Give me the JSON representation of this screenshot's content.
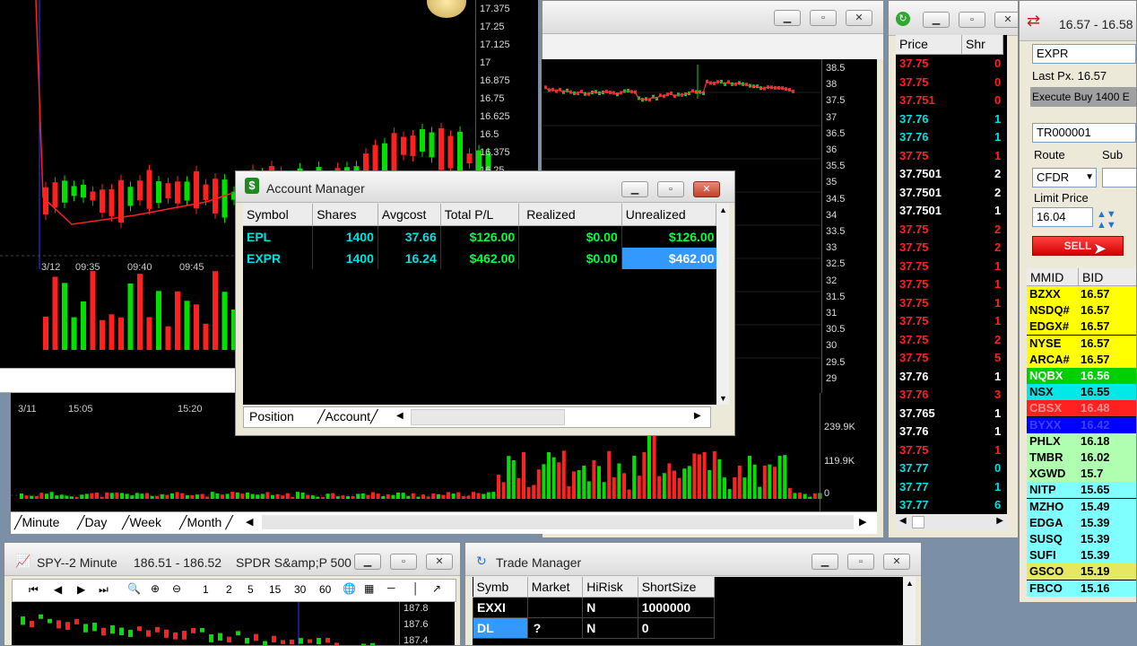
{
  "top_chart": {
    "y_ticks": [
      "17.375",
      "17.25",
      "17.125",
      "17",
      "16.875",
      "16.75",
      "16.625",
      "16.5",
      "16.375",
      "16.25"
    ],
    "x_labels": [
      "3/12",
      "09:35",
      "09:40",
      "09:45"
    ]
  },
  "mid_chart": {
    "x_labels": [
      "3/11",
      "15:05",
      "15:20"
    ],
    "tabs": [
      "Minute",
      "Day",
      "Week",
      "Month"
    ]
  },
  "right_chart": {
    "y_ticks": [
      "38.5",
      "38",
      "37.5",
      "37",
      "36.5",
      "36",
      "35.5",
      "35",
      "34.5",
      "34",
      "33.5",
      "33",
      "32.5",
      "32",
      "31.5",
      "31",
      "30.5",
      "30",
      "29.5",
      "29"
    ],
    "vol_ticks": [
      "239.9K",
      "119.9K",
      "0"
    ]
  },
  "account_manager": {
    "title": "Account Manager",
    "columns": [
      "Symbol",
      "Shares",
      "Avgcost",
      "Total P/L",
      "Realized",
      "Unrealized"
    ],
    "rows": [
      {
        "symbol": "EPL",
        "shares": "1400",
        "avgcost": "37.66",
        "total_pl": "$126.00",
        "realized": "$0.00",
        "unrealized": "$126.00"
      },
      {
        "symbol": "EXPR",
        "shares": "1400",
        "avgcost": "16.24",
        "total_pl": "$462.00",
        "realized": "$0.00",
        "unrealized": "$462.00"
      }
    ],
    "tabs": [
      "Position",
      "Account"
    ]
  },
  "time_sales": {
    "columns": [
      "Price",
      "Shr"
    ],
    "rows": [
      {
        "price": "37.75",
        "shr": "0",
        "color": "#ff2020"
      },
      {
        "price": "37.75",
        "shr": "0",
        "color": "#ff2020"
      },
      {
        "price": "37.751",
        "shr": "0",
        "color": "#ff2020"
      },
      {
        "price": "37.76",
        "shr": "1",
        "color": "#00e0e0"
      },
      {
        "price": "37.76",
        "shr": "1",
        "color": "#00e0e0"
      },
      {
        "price": "37.75",
        "shr": "1",
        "color": "#ff2020"
      },
      {
        "price": "37.7501",
        "shr": "2",
        "color": "#ffffff"
      },
      {
        "price": "37.7501",
        "shr": "2",
        "color": "#ffffff"
      },
      {
        "price": "37.7501",
        "shr": "1",
        "color": "#ffffff"
      },
      {
        "price": "37.75",
        "shr": "2",
        "color": "#ff2020"
      },
      {
        "price": "37.75",
        "shr": "2",
        "color": "#ff2020"
      },
      {
        "price": "37.75",
        "shr": "1",
        "color": "#ff2020"
      },
      {
        "price": "37.75",
        "shr": "1",
        "color": "#ff2020"
      },
      {
        "price": "37.75",
        "shr": "1",
        "color": "#ff2020"
      },
      {
        "price": "37.75",
        "shr": "1",
        "color": "#ff2020"
      },
      {
        "price": "37.75",
        "shr": "2",
        "color": "#ff2020"
      },
      {
        "price": "37.75",
        "shr": "5",
        "color": "#ff2020"
      },
      {
        "price": "37.76",
        "shr": "1",
        "color": "#ffffff"
      },
      {
        "price": "37.76",
        "shr": "3",
        "color": "#ff2020"
      },
      {
        "price": "37.765",
        "shr": "1",
        "color": "#ffffff"
      },
      {
        "price": "37.76",
        "shr": "1",
        "color": "#ffffff"
      },
      {
        "price": "37.75",
        "shr": "1",
        "color": "#ff2020"
      },
      {
        "price": "37.77",
        "shr": "0",
        "color": "#00e0e0"
      },
      {
        "price": "37.77",
        "shr": "1",
        "color": "#00e0e0"
      },
      {
        "price": "37.77",
        "shr": "6",
        "color": "#00e0e0"
      }
    ]
  },
  "order_entry": {
    "title": "16.57 - 16.58",
    "symbol": "EXPR",
    "last_px_label": "Last Px.",
    "last_px": "16.57",
    "execute_text": "Execute Buy 1400 E",
    "account": "TR000001",
    "route_label": "Route",
    "sub_label": "Sub",
    "route": "CFDR",
    "limit_label": "Limit Price",
    "limit_price": "16.04",
    "sell_label": "SELL",
    "level2_columns": [
      "MMID",
      "BID"
    ],
    "level2": [
      {
        "mmid": "BZXX",
        "bid": "16.57",
        "bg": "#ffff00",
        "fg": "#000"
      },
      {
        "mmid": "NSDQ#",
        "bid": "16.57",
        "bg": "#ffff00",
        "fg": "#000"
      },
      {
        "mmid": "EDGX#",
        "bid": "16.57",
        "bg": "#ffff00",
        "fg": "#000"
      },
      {
        "mmid": "NYSE",
        "bid": "16.57",
        "bg": "#ffff00",
        "fg": "#000"
      },
      {
        "mmid": "ARCA#",
        "bid": "16.57",
        "bg": "#ffff00",
        "fg": "#000"
      },
      {
        "mmid": "NQBX",
        "bid": "16.56",
        "bg": "#00d000",
        "fg": "#ffffff"
      },
      {
        "mmid": "NSX",
        "bid": "16.55",
        "bg": "#00e8e8",
        "fg": "#000"
      },
      {
        "mmid": "CBSX",
        "bid": "16.48",
        "bg": "#ff2020",
        "fg": "#ff9090"
      },
      {
        "mmid": "BYXX",
        "bid": "16.42",
        "bg": "#0000ff",
        "fg": "#4040ff"
      },
      {
        "mmid": "PHLX",
        "bid": "16.18",
        "bg": "#b0ffb0",
        "fg": "#000"
      },
      {
        "mmid": "TMBR",
        "bid": "16.02",
        "bg": "#b0ffb0",
        "fg": "#000"
      },
      {
        "mmid": "XGWD",
        "bid": "15.7",
        "bg": "#b0ffb0",
        "fg": "#000"
      },
      {
        "mmid": "NITP",
        "bid": "15.65",
        "bg": "#80ffff",
        "fg": "#000"
      },
      {
        "mmid": "MZHO",
        "bid": "15.49",
        "bg": "#80ffff",
        "fg": "#000"
      },
      {
        "mmid": "EDGA",
        "bid": "15.39",
        "bg": "#80ffff",
        "fg": "#000"
      },
      {
        "mmid": "SUSQ",
        "bid": "15.39",
        "bg": "#80ffff",
        "fg": "#000"
      },
      {
        "mmid": "SUFI",
        "bid": "15.39",
        "bg": "#80ffff",
        "fg": "#000"
      },
      {
        "mmid": "GSCO",
        "bid": "15.19",
        "bg": "#e8e860",
        "fg": "#000"
      },
      {
        "mmid": "FBCO",
        "bid": "15.16",
        "bg": "#80ffff",
        "fg": "#000"
      }
    ]
  },
  "spy_window": {
    "title": "SPY--2 Minute",
    "quote": "186.51 - 186.52",
    "desc": "SPDR S&amp;P 500",
    "y_ticks": [
      "187.8",
      "187.6",
      "187.4"
    ],
    "toolbar": [
      "1",
      "2",
      "5",
      "15",
      "30",
      "60"
    ]
  },
  "trade_manager": {
    "title": "Trade Manager",
    "columns": [
      "Symb",
      "Market",
      "HiRisk",
      "ShortSize"
    ],
    "rows": [
      {
        "symb": "EXXI",
        "market": "",
        "hirisk": "N",
        "shortsize": "1000000"
      },
      {
        "symb": "DL",
        "market": "?",
        "hirisk": "N",
        "shortsize": "0"
      }
    ]
  }
}
